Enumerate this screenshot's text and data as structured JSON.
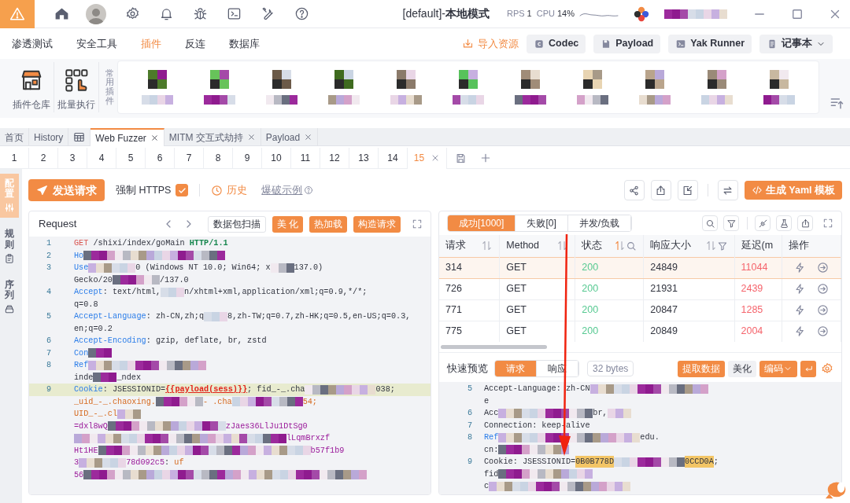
{
  "title_bar": {
    "title": "[default]-**本地模式**",
    "rps_label": "RPS",
    "rps": "1",
    "cpu_label": "CPU",
    "cpu": "14%",
    "account": {
      "kind": "mosaic"
    }
  },
  "menu": [
    {
      "label": "渗透测试",
      "selected": false
    },
    {
      "label": "安全工具",
      "selected": false
    },
    {
      "label": "插件",
      "selected": true
    },
    {
      "label": "反连",
      "selected": false
    },
    {
      "label": "数据库",
      "selected": false
    }
  ],
  "quick_actions": [
    {
      "label": "导入资源",
      "kind": "link"
    },
    {
      "label": "Codec",
      "kind": "codec"
    },
    {
      "label": "Payload",
      "kind": "payload"
    },
    {
      "label": "Yak Runner",
      "kind": "runner"
    },
    {
      "label": "记事本",
      "kind": "notebook"
    }
  ],
  "plugin_tools": [
    {
      "label": "插件仓库",
      "kind": "store"
    },
    {
      "label": "批量执行",
      "kind": "batch"
    }
  ],
  "common_plugins": {
    "label": "常用插件"
  },
  "page_tabs": [
    {
      "kind": "text",
      "label": "首页",
      "selected": false,
      "closable": false
    },
    {
      "kind": "text",
      "label": "History",
      "selected": false,
      "closable": false
    },
    {
      "kind": "icon",
      "selected": false,
      "closable": false
    },
    {
      "kind": "text",
      "label": "Web Fuzzer",
      "selected": true,
      "closable": true
    },
    {
      "kind": "text",
      "label": "MITM 交互式劫持",
      "selected": false,
      "closable": true
    },
    {
      "kind": "text",
      "label": "Payload",
      "selected": false,
      "closable": true
    }
  ],
  "fuzzer_tabs": [
    {
      "label": "1",
      "selected": false
    },
    {
      "label": "2",
      "selected": false
    },
    {
      "label": "3",
      "selected": false
    },
    {
      "label": "4",
      "selected": false
    },
    {
      "label": "5",
      "selected": false
    },
    {
      "label": "6",
      "selected": false
    },
    {
      "label": "7",
      "selected": false
    },
    {
      "label": "8",
      "selected": false
    },
    {
      "label": "9",
      "selected": false
    },
    {
      "label": "10",
      "selected": false
    },
    {
      "label": "11",
      "selected": false
    },
    {
      "label": "12",
      "selected": false
    },
    {
      "label": "13",
      "selected": false
    },
    {
      "label": "14",
      "selected": false
    },
    {
      "label": "15",
      "selected": true
    }
  ],
  "side_tabs": [
    {
      "label": "配置",
      "kind": "sliders",
      "selected": true
    },
    {
      "label": "规则",
      "kind": "clipboard",
      "selected": false
    },
    {
      "label": "序列",
      "kind": "layers",
      "selected": false
    }
  ],
  "toolbar": {
    "send": "发送请求",
    "force_https": {
      "label": "强制 HTTPS",
      "checked": true
    },
    "history": "历史",
    "example": "爆破示例",
    "yaml": "生成 Yaml 模板"
  },
  "request": {
    "title": "Request",
    "buttons": [
      {
        "label": "数据包扫描",
        "kind": "outline"
      },
      {
        "label": "美 化",
        "kind": "primary"
      },
      {
        "label": "热加载",
        "kind": "primary"
      },
      {
        "label": "构造请求",
        "kind": "primary"
      }
    ],
    "lines": [
      {
        "number": "1",
        "highlighted": false,
        "segments": [
          {
            "kind": "method",
            "text": "GET"
          },
          {
            "kind": "value",
            "text": " /shixi/index/goMain "
          },
          {
            "kind": "version",
            "text": "HTTP/1.1"
          }
        ]
      },
      {
        "number": "2",
        "highlighted": false,
        "segments": [
          {
            "kind": "key",
            "text": "Ho"
          },
          {
            "kind": "mosaic"
          },
          {
            "kind": "mosaic"
          },
          {
            "kind": "mosaic"
          },
          {
            "kind": "mosaic"
          },
          {
            "kind": "mosaic"
          },
          {
            "kind": "mosaic"
          }
        ]
      },
      {
        "number": "3",
        "highlighted": false,
        "segments": [
          {
            "kind": "key",
            "text": "Use"
          },
          {
            "kind": "mosaic"
          },
          {
            "kind": "mosaic"
          },
          {
            "kind": "value",
            "text": "0 (Windows NT 10.0; Win64; x"
          },
          {
            "kind": "mosaic"
          },
          {
            "kind": "value",
            "text": "137.0)"
          }
        ]
      },
      {
        "highlighted": false,
        "segments": [
          {
            "kind": "value",
            "text": "Gecko/20"
          },
          {
            "kind": "mosaic"
          },
          {
            "kind": "mosaic"
          },
          {
            "kind": "value",
            "text": "/137.0"
          }
        ]
      },
      {
        "number": "4",
        "highlighted": false,
        "segments": [
          {
            "kind": "key",
            "text": "Accept"
          },
          {
            "kind": "value",
            "text": ": text/html,"
          },
          {
            "kind": "mosaic"
          },
          {
            "kind": "value",
            "text": "n/xhtml+xml,application/xml;q=0.9,*/*;"
          }
        ]
      },
      {
        "highlighted": false,
        "segments": [
          {
            "kind": "value",
            "text": "q=0.8"
          }
        ]
      },
      {
        "number": "5",
        "highlighted": false,
        "segments": [
          {
            "kind": "key",
            "text": "Accept-Language"
          },
          {
            "kind": "value",
            "text": ": zh-CN,zh;q"
          },
          {
            "kind": "mosaic"
          },
          {
            "kind": "value",
            "text": "8,zh-TW;q=0.7,zh-HK;q=0.5,en-US;q=0.3,"
          }
        ]
      },
      {
        "highlighted": false,
        "segments": [
          {
            "kind": "value",
            "text": "en;q=0.2"
          }
        ]
      },
      {
        "number": "6",
        "highlighted": false,
        "segments": [
          {
            "kind": "key",
            "text": "Accept-Encoding"
          },
          {
            "kind": "value",
            "text": ": gzip, deflate, br, zstd"
          }
        ]
      },
      {
        "number": "7",
        "highlighted": false,
        "segments": [
          {
            "kind": "key",
            "text": "Con"
          },
          {
            "kind": "mosaic"
          }
        ]
      },
      {
        "number": "8",
        "highlighted": false,
        "segments": [
          {
            "kind": "key",
            "text": "Ref"
          },
          {
            "kind": "mosaic"
          },
          {
            "kind": "mosaic"
          },
          {
            "kind": "mosaic"
          },
          {
            "kind": "mosaic"
          },
          {
            "kind": "mosaic"
          }
        ]
      },
      {
        "highlighted": false,
        "segments": [
          {
            "kind": "value",
            "text": "inde"
          },
          {
            "kind": "mosaic"
          },
          {
            "kind": "value",
            "text": "_ndex"
          }
        ]
      },
      {
        "number": "9",
        "highlighted": true,
        "segments": [
          {
            "kind": "key",
            "text": "Cookie"
          },
          {
            "kind": "value",
            "text": ": JSESSIONID="
          },
          {
            "kind": "payload",
            "text": "{{payload(sess)}}"
          },
          {
            "kind": "value",
            "text": "; fid_-_.cha"
          },
          {
            "kind": "mosaic"
          },
          {
            "kind": "mosaic"
          },
          {
            "kind": "mosaic"
          },
          {
            "kind": "value",
            "text": "038;"
          }
        ]
      },
      {
        "highlighted": false,
        "segments": [
          {
            "kind": "cookie",
            "text": "_uid_-_.chaoxing."
          },
          {
            "kind": "mosaic"
          },
          {
            "kind": "mosaic"
          },
          {
            "kind": "cookie",
            "text": "- .cha"
          },
          {
            "kind": "mosaic"
          },
          {
            "kind": "mosaic"
          },
          {
            "kind": "mosaic"
          },
          {
            "kind": "cookie",
            "text": "54;"
          }
        ]
      },
      {
        "highlighted": false,
        "segments": [
          {
            "kind": "cookie",
            "text": "UID_-_.cl"
          },
          {
            "kind": "mosaic"
          }
        ]
      },
      {
        "highlighted": false,
        "segments": [
          {
            "kind": "cookieval",
            "text": "=dxl8wQ"
          },
          {
            "kind": "mosaic"
          },
          {
            "kind": "mosaic"
          },
          {
            "kind": "mosaic"
          },
          {
            "kind": "mosaic"
          },
          {
            "kind": "mosaic"
          },
          {
            "kind": "cookieval",
            "text": "zJaes36LlJu1DtSg0"
          }
        ]
      },
      {
        "highlighted": false,
        "segments": [
          {
            "kind": "mosaic"
          },
          {
            "kind": "mosaic"
          },
          {
            "kind": "mosaic"
          },
          {
            "kind": "mosaic"
          },
          {
            "kind": "mosaic"
          },
          {
            "kind": "mosaic"
          },
          {
            "kind": "mosaic"
          },
          {
            "kind": "mosaic"
          },
          {
            "kind": "mosaic"
          },
          {
            "kind": "cookieval",
            "text": "lLqmBrxzf"
          }
        ]
      },
      {
        "highlighted": false,
        "segments": [
          {
            "kind": "cookieval",
            "text": "Ht1HE"
          },
          {
            "kind": "mosaic"
          },
          {
            "kind": "mosaic"
          },
          {
            "kind": "mosaic"
          },
          {
            "kind": "mosaic"
          },
          {
            "kind": "mosaic"
          },
          {
            "kind": "mosaic"
          },
          {
            "kind": "mosaic"
          },
          {
            "kind": "mosaic"
          },
          {
            "kind": "mosaic"
          },
          {
            "kind": "cookieval",
            "text": "b57f1b9"
          }
        ]
      },
      {
        "highlighted": false,
        "segments": [
          {
            "kind": "cookieval",
            "text": "3"
          },
          {
            "kind": "mosaic"
          },
          {
            "kind": "mosaic"
          },
          {
            "kind": "cookieval",
            "text": "78d092c5"
          },
          {
            "kind": "value",
            "text": ": "
          },
          {
            "kind": "cookie",
            "text": "uf"
          }
        ]
      },
      {
        "highlighted": false,
        "segments": [
          {
            "kind": "cookieval",
            "text": "56"
          },
          {
            "kind": "mosaic"
          },
          {
            "kind": "mosaic"
          },
          {
            "kind": "mosaic"
          },
          {
            "kind": "mosaic"
          },
          {
            "kind": "mosaic"
          },
          {
            "kind": "mosaic"
          },
          {
            "kind": "mosaic"
          },
          {
            "kind": "mosaic"
          },
          {
            "kind": "mosaic"
          },
          {
            "kind": "mosaic"
          },
          {
            "kind": "mosaic"
          },
          {
            "kind": "mosaic"
          }
        ]
      }
    ]
  },
  "response": {
    "tabs": [
      {
        "label": "成功[1000]",
        "selected": true
      },
      {
        "label": "失败[0]",
        "selected": false
      },
      {
        "label": "并发/负载",
        "selected": false
      }
    ],
    "table": {
      "columns": [
        {
          "label": "请求",
          "kind": "text",
          "sortable": true,
          "sorted_ascending": false,
          "search": false,
          "filter": false
        },
        {
          "label": "Method",
          "kind": "text",
          "sortable": true,
          "sorted_ascending": false,
          "search": false,
          "filter": false
        },
        {
          "label": "状态",
          "kind": "status",
          "sortable": true,
          "sorted_ascending": true,
          "search": true,
          "filter": false
        },
        {
          "label": "响应大小",
          "kind": "text",
          "sortable": true,
          "sorted_ascending": false,
          "search": false,
          "filter": true
        },
        {
          "label": "延迟(m",
          "kind": "latency",
          "sortable": false,
          "search": false,
          "filter": false
        },
        {
          "label": "操作",
          "kind": "actions",
          "sortable": false,
          "search": false,
          "filter": false
        }
      ],
      "rows": [
        {
          "selected": true,
          "cells": [
            "314",
            "GET",
            "200",
            "24849",
            "11044"
          ]
        },
        {
          "selected": false,
          "cells": [
            "726",
            "GET",
            "200",
            "21931",
            "2439"
          ]
        },
        {
          "selected": false,
          "cells": [
            "771",
            "GET",
            "200",
            "20847",
            "1285"
          ]
        },
        {
          "selected": false,
          "cells": [
            "775",
            "GET",
            "200",
            "20849",
            "2004"
          ]
        }
      ]
    },
    "preview": {
      "label": "快速预览",
      "tabs": [
        {
          "label": "请求",
          "selected": true
        },
        {
          "label": "响应",
          "selected": false
        }
      ],
      "size": "32 bytes",
      "buttons": [
        {
          "label": "提取数据",
          "kind": "primary"
        },
        {
          "label": "美化",
          "kind": "plain"
        },
        {
          "label": "编码",
          "kind": "dropdown"
        }
      ],
      "lines": [
        {
          "number": "5",
          "segments": [
            {
              "kind": "value",
              "text": "Accept-Language: zh-CN"
            },
            {
              "kind": "mosaic"
            },
            {
              "kind": "mosaic"
            },
            {
              "kind": "mosaic"
            },
            {
              "kind": "mosaic"
            },
            {
              "kind": "mosaic"
            }
          ]
        },
        {
          "segments": [
            {
              "kind": "value",
              "text": "e"
            }
          ]
        },
        {
          "number": "6",
          "segments": [
            {
              "kind": "value",
              "text": "Acc"
            },
            {
              "kind": "mosaic"
            },
            {
              "kind": "mosaic"
            },
            {
              "kind": "mosaic"
            },
            {
              "kind": "mosaic"
            },
            {
              "kind": "value",
              "text": "br,"
            },
            {
              "kind": "mosaic"
            }
          ]
        },
        {
          "number": "7",
          "segments": [
            {
              "kind": "value",
              "text": "Connection: keep-alive"
            }
          ]
        },
        {
          "number": "8",
          "segments": [
            {
              "kind": "key",
              "text": "Ref"
            },
            {
              "kind": "mosaic"
            },
            {
              "kind": "mosaic"
            },
            {
              "kind": "mosaic"
            },
            {
              "kind": "mosaic"
            },
            {
              "kind": "mosaic"
            },
            {
              "kind": "mosaic"
            },
            {
              "kind": "value",
              "text": "edu."
            }
          ]
        },
        {
          "segments": [
            {
              "kind": "value",
              "text": "cn:"
            },
            {
              "kind": "mosaic"
            },
            {
              "kind": "mosaic"
            },
            {
              "kind": "mosaic"
            }
          ]
        },
        {
          "number": "9",
          "segments": [
            {
              "kind": "value",
              "text": "Cookie: JSESSIONID="
            },
            {
              "kind": "match",
              "text": "0B0B778D"
            },
            {
              "kind": "mosaic"
            },
            {
              "kind": "mosaic"
            },
            {
              "kind": "mosaic"
            },
            {
              "kind": "match",
              "text": "0CCD0A"
            },
            {
              "kind": "value",
              "text": ";"
            }
          ]
        },
        {
          "segments": [
            {
              "kind": "value",
              "text": "fid"
            },
            {
              "kind": "mosaic"
            },
            {
              "kind": "mosaic"
            },
            {
              "kind": "mosaic"
            },
            {
              "kind": "mosaic"
            }
          ]
        },
        {
          "segments": [
            {
              "kind": "value",
              "text": "c"
            },
            {
              "kind": "mosaic"
            },
            {
              "kind": "mosaic"
            },
            {
              "kind": "mosaic"
            },
            {
              "kind": "mosaic"
            },
            {
              "kind": "mosaic"
            },
            {
              "kind": "mosaic"
            }
          ]
        }
      ]
    }
  },
  "annotation": {
    "kind": "arrow"
  }
}
